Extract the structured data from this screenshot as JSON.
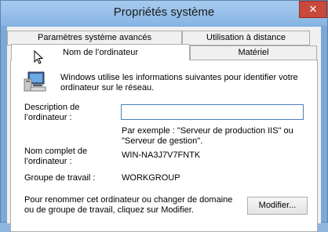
{
  "window": {
    "title": "Propriétés système",
    "close_glyph": "✕"
  },
  "tabs": {
    "row1": [
      {
        "label": "Paramètres système avancés"
      },
      {
        "label": "Utilisation à distance"
      }
    ],
    "row2": [
      {
        "label": "Nom de l’ordinateur",
        "selected": true
      },
      {
        "label": "Matériel"
      }
    ]
  },
  "panel": {
    "intro": [
      "Windows utilise les informations suivantes pour identifier votre",
      "ordinateur sur le réseau."
    ],
    "description_label": [
      "Description de",
      "l’ordinateur :"
    ],
    "description_value": "",
    "example": [
      "Par exemple : \"Serveur de production IIS\" ou",
      "\"Serveur de gestion\"."
    ],
    "full_name_label": [
      "Nom complet de",
      "l’ordinateur :"
    ],
    "full_name_value": "WIN-NA3J7V7FNTK",
    "workgroup_label": "Groupe de travail :",
    "workgroup_value": "WORKGROUP",
    "rename_text": [
      "Pour renommer cet ordinateur ou changer de domaine",
      "ou de groupe de travail, cliquez sur Modifier."
    ],
    "modify_button": "Modifier..."
  },
  "icons": {
    "computer": "computer-icon",
    "cursor": "mouse-cursor-icon"
  }
}
